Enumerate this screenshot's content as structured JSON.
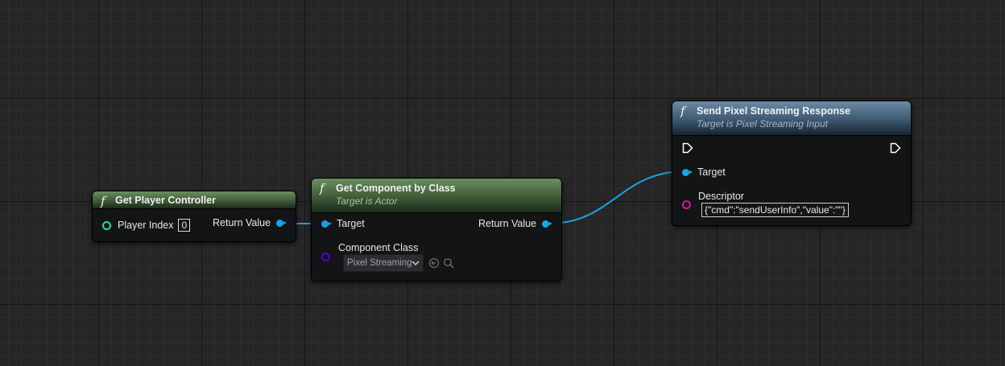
{
  "nodes": {
    "get_player_controller": {
      "func_glyph": "f",
      "title": "Get Player Controller",
      "player_index_label": "Player Index",
      "player_index_value": "0",
      "return_label": "Return Value"
    },
    "get_component_by_class": {
      "func_glyph": "f",
      "title": "Get Component by Class",
      "subtitle": "Target is Actor",
      "target_label": "Target",
      "return_label": "Return Value",
      "component_class_label": "Component Class",
      "component_class_value": "Pixel Streaming"
    },
    "send_pixel_streaming_response": {
      "func_glyph": "f",
      "title": "Send Pixel Streaming Response",
      "subtitle": "Target is Pixel Streaming Input",
      "target_label": "Target",
      "descriptor_label": "Descriptor",
      "descriptor_value": "{\"cmd\":\"sendUserInfo\",\"value\":\"\"}"
    }
  },
  "colors": {
    "object_pin": "#1aa3e6",
    "int_pin": "#1fe0a0",
    "class_pin": "#5a00c8",
    "string_pin": "#e0148c",
    "exec_pin": "#ffffff",
    "pure_header": "#5e8454",
    "call_header": "#5c7a96"
  }
}
